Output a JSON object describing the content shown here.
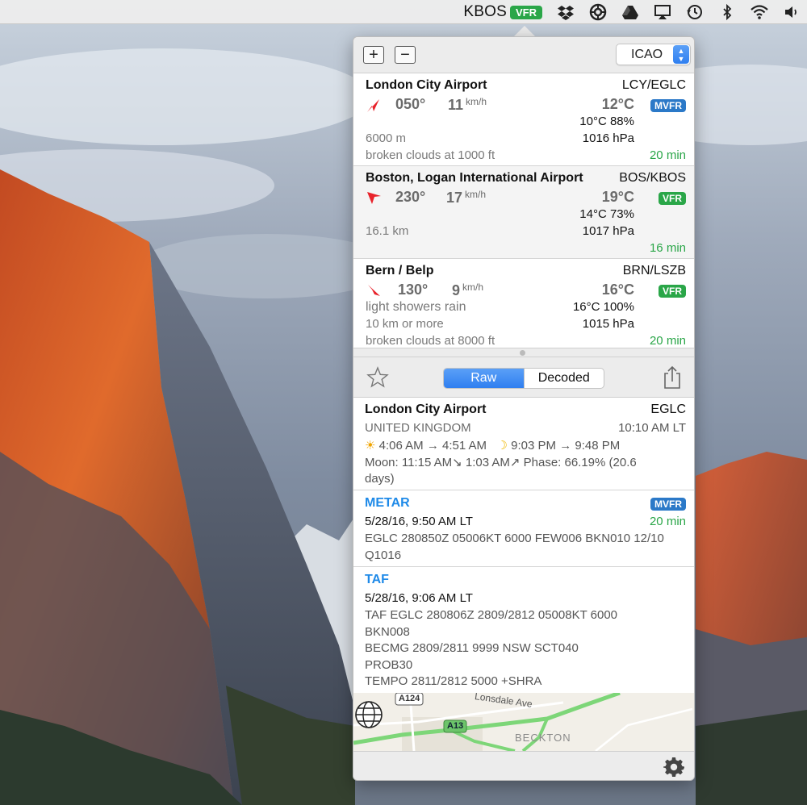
{
  "menubar": {
    "station_code": "KBOS",
    "station_category": "VFR",
    "icons": [
      "dropbox-icon",
      "creative-cloud-icon",
      "google-drive-icon",
      "airplay-icon",
      "time-machine-icon",
      "bluetooth-icon",
      "wifi-icon",
      "volume-icon"
    ]
  },
  "toolbar": {
    "add_label": "+",
    "remove_label": "−",
    "code_format": "ICAO"
  },
  "stations": [
    {
      "name": "London City Airport",
      "codes": "LCY/EGLC",
      "wind_dir": "050°",
      "wind_speed": "11",
      "wind_unit": "km/h",
      "temp": "12°C",
      "category": "MVFR",
      "dew_humidity": "10°C 88%",
      "visibility": "6000 m",
      "pressure": "1016 hPa",
      "clouds": "broken clouds at 1000 ft",
      "age": "20 min"
    },
    {
      "name": "Boston, Logan International Airport",
      "codes": "BOS/KBOS",
      "wind_dir": "230°",
      "wind_speed": "17",
      "wind_unit": "km/h",
      "temp": "19°C",
      "category": "VFR",
      "dew_humidity": "14°C 73%",
      "visibility": "16.1 km",
      "pressure": "1017 hPa",
      "age": "16 min"
    },
    {
      "name": "Bern / Belp",
      "codes": "BRN/LSZB",
      "wind_dir": "130°",
      "wind_speed": "9",
      "wind_unit": "km/h",
      "temp": "16°C",
      "category": "VFR",
      "weather": "light showers rain",
      "dew_humidity": "16°C 100%",
      "visibility": "10 km or more",
      "pressure": "1015 hPa",
      "clouds": "broken clouds at 8000 ft",
      "age": "20 min"
    }
  ],
  "detail_toolbar": {
    "raw_label": "Raw",
    "decoded_label": "Decoded"
  },
  "detail": {
    "name": "London City Airport",
    "icao": "EGLC",
    "country": "UNITED KINGDOM",
    "local_time": "10:10 AM LT",
    "sun_line": "4:06 AM → 4:51 AM",
    "moon_line": "9:03 PM → 9:48 PM",
    "moon_phase_line1": "Moon: 11:15 AM↘ 1:03 AM↗ Phase: 66.19% (20.6",
    "moon_phase_line2": "days)",
    "metar": {
      "title": "METAR",
      "category": "MVFR",
      "time": "5/28/16, 9:50 AM LT",
      "age": "20 min",
      "line1": "EGLC 280850Z 05006KT 6000 FEW006 BKN010 12/10",
      "line2": "Q1016"
    },
    "taf": {
      "title": "TAF",
      "time": "5/28/16, 9:06 AM LT",
      "lines": [
        "TAF EGLC 280806Z 2809/2812 05008KT 6000",
        "BKN008",
        "BECMG 2809/2811 9999 NSW SCT040",
        "PROB30",
        "TEMPO 2811/2812 5000 +SHRA"
      ]
    }
  },
  "map": {
    "road_a124": "A124",
    "road_a13": "A13",
    "street": "Lonsdale Ave",
    "place": "BECKTON"
  },
  "colors": {
    "vfr": "#2aa648",
    "mvfr": "#2b79c8",
    "accent": "#1f8ae8",
    "wind_arrow": "#e8232b"
  }
}
